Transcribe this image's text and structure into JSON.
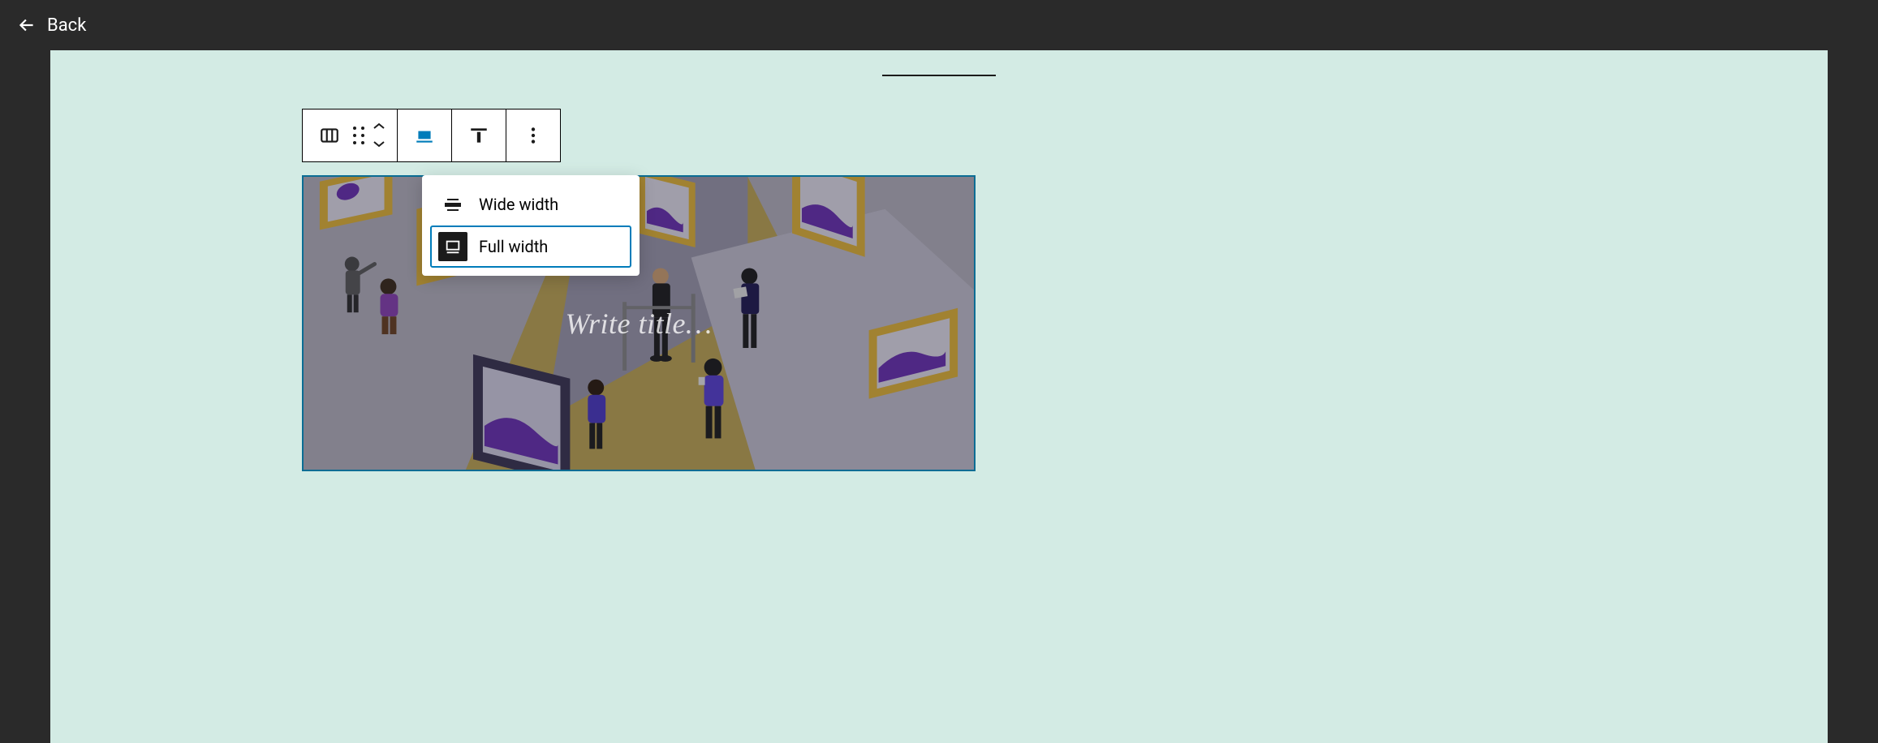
{
  "header": {
    "back_label": "Back"
  },
  "toolbar": {
    "block_type": "columns",
    "align_active": "full"
  },
  "dropdown": {
    "items": [
      {
        "label": "Wide width",
        "value": "wide",
        "selected": false
      },
      {
        "label": "Full width",
        "value": "full",
        "selected": true
      }
    ]
  },
  "cover": {
    "title_placeholder": "Write title…"
  },
  "colors": {
    "canvas_bg": "#d3ebe4",
    "accent": "#007cba",
    "text_dark": "#1b1b1b"
  }
}
